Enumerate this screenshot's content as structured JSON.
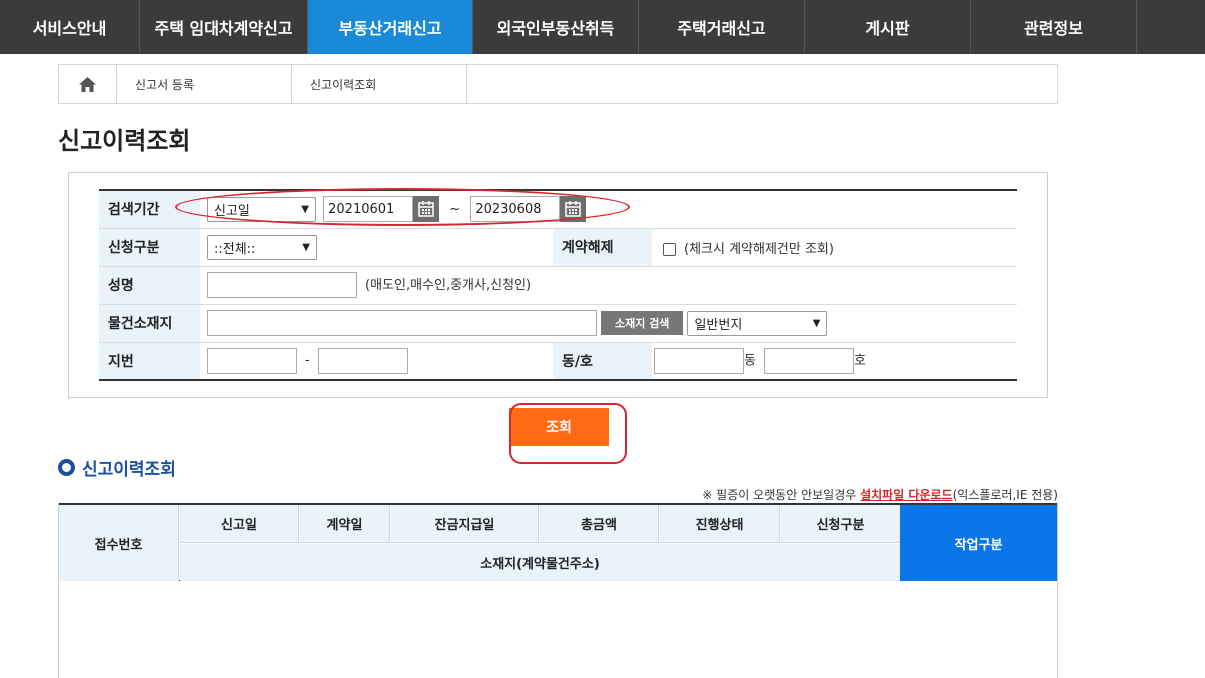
{
  "nav": {
    "items": [
      {
        "label": "서비스안내"
      },
      {
        "label": "주택 임대차계약신고"
      },
      {
        "label": "부동산거래신고"
      },
      {
        "label": "외국인부동산취득"
      },
      {
        "label": "주택거래신고"
      },
      {
        "label": "게시판"
      },
      {
        "label": "관련정보"
      }
    ],
    "active_index": 2
  },
  "breadcrumb": {
    "home_icon": "home-icon",
    "items": [
      "신고서 등록",
      "신고이력조회"
    ]
  },
  "page_title": "신고이력조회",
  "search": {
    "period_label": "검색기간",
    "date_type_value": "신고일",
    "date_from": "20210601",
    "date_separator": "~",
    "date_to": "20230608",
    "apply_type_label": "신청구분",
    "apply_type_value": "::전체::",
    "cancel_label": "계약해제",
    "cancel_note": "(체크시 계약해제건만 조회)",
    "name_label": "성명",
    "name_value": "",
    "name_note": "(매도인,매수인,중개사,신청인)",
    "address_label": "물건소재지",
    "address_value": "",
    "address_search_button": "소재지 검색",
    "address_type_value": "일반번지",
    "lot_label": "지번",
    "lot_dash": "-",
    "dongho_label": "동/호",
    "dong_suffix": "동",
    "ho_suffix": "호",
    "search_button": "조회"
  },
  "results": {
    "section_title": "신고이력조회",
    "notice_prefix": "※ 필증이 오랫동안 안보일경우 ",
    "notice_link": "설치파일 다운로드",
    "notice_suffix": "(익스플로러,IE 전용)",
    "columns": {
      "receipt_no": "접수번호",
      "report_date": "신고일",
      "contract_date": "계약일",
      "balance_date": "잔금지급일",
      "total_amount": "총금액",
      "status": "진행상태",
      "apply_type": "신청구분",
      "address": "소재지(계약물건주소)",
      "action": "작업구분"
    }
  },
  "colors": {
    "nav_bg": "#3b3b3b",
    "nav_active": "#1a8ad8",
    "search_button": "#ff6a13",
    "highlight": "#d7262e",
    "section_title": "#1d4f9e",
    "action_header": "#0a75e6",
    "header_cell": "#eaf2fa"
  }
}
